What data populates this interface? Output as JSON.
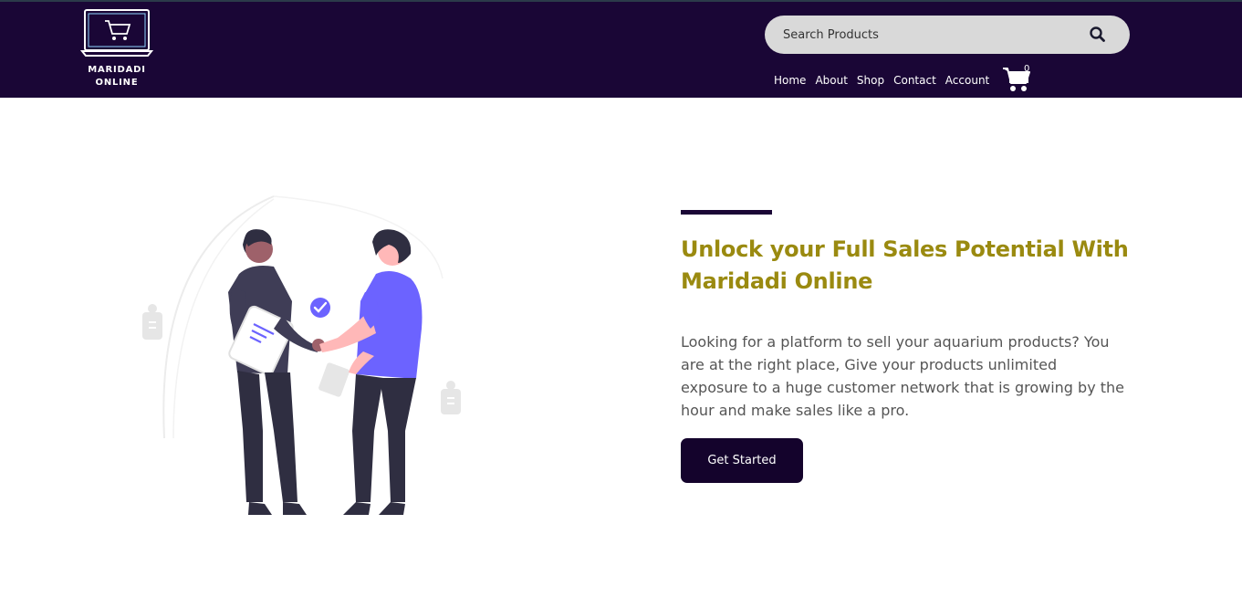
{
  "header": {
    "logo_text_line1": "MARIDADI",
    "logo_text_line2": "ONLINE",
    "search_placeholder": "Search Products",
    "search_icon": "search-icon",
    "nav": [
      {
        "label": "Home"
      },
      {
        "label": "About"
      },
      {
        "label": "Shop"
      },
      {
        "label": "Contact"
      },
      {
        "label": "Account"
      }
    ],
    "cart_icon": "shopping-cart-icon",
    "cart_count": "0"
  },
  "hero": {
    "title": "Unlock your Full Sales Potential With Maridadi Online",
    "description": "Looking for a platform to sell your aquarium products? You are at the right place, Give your products unlimited exposure to a huge customer network that is growing by the hour and make sales like a pro.",
    "cta_label": "Get Started",
    "illustration": "handshake-illustration"
  },
  "colors": {
    "header_bg": "#1a0636",
    "title": "#9a8a10",
    "accent_purple": "#6c63ff",
    "button_bg": "#14032c"
  }
}
